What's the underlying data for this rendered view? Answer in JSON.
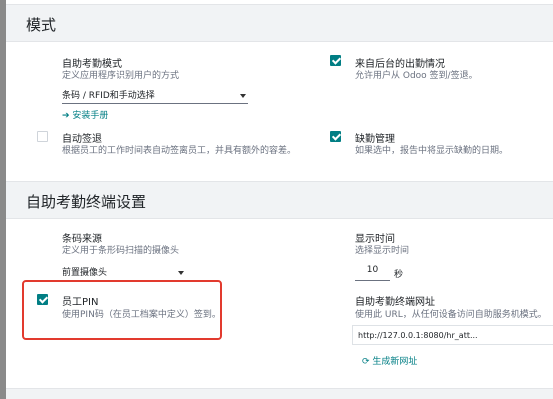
{
  "section1": {
    "title": "模式",
    "kiosk_mode": {
      "title": "自助考勤模式",
      "desc": "定义应用程序识别用户的方式",
      "select_value": "条码 / RFID和手动选择",
      "manual_link": "安装手册",
      "manual_arrow": "➔"
    },
    "backend_attendance": {
      "title": "来自后台的出勤情况",
      "desc": "允许用户从 Odoo 签到/签退。",
      "checked": true
    },
    "auto_checkout": {
      "title": "自动签退",
      "desc": "根据员工的工作时间表自动签离员工，并具有额外的容差。",
      "checked": false
    },
    "absence_management": {
      "title": "缺勤管理",
      "desc": "如果选中，报告中将显示缺勤的日期。",
      "checked": true
    }
  },
  "section2": {
    "title": "自助考勤终端设置",
    "barcode_source": {
      "title": "条码来源",
      "desc": "定义用于条形码扫描的摄像头",
      "select_value": "前置摄像头"
    },
    "display_time": {
      "title": "显示时间",
      "desc": "选择显示时间",
      "value": "10",
      "unit": "秒"
    },
    "employee_pin": {
      "title": "员工PIN",
      "desc": "使用PIN码（在员工档案中定义）签到。",
      "checked": true
    },
    "kiosk_url": {
      "title": "自助考勤终端网址",
      "desc": "使用此 URL，从任何设备访问自助服务机模式。",
      "url": "http://127.0.0.1:8080/hr_att...",
      "regenerate": "生成新网址",
      "regen_icon": "⟳"
    }
  },
  "colors": {
    "accent": "#017e84",
    "highlight": "#e23a2e"
  }
}
